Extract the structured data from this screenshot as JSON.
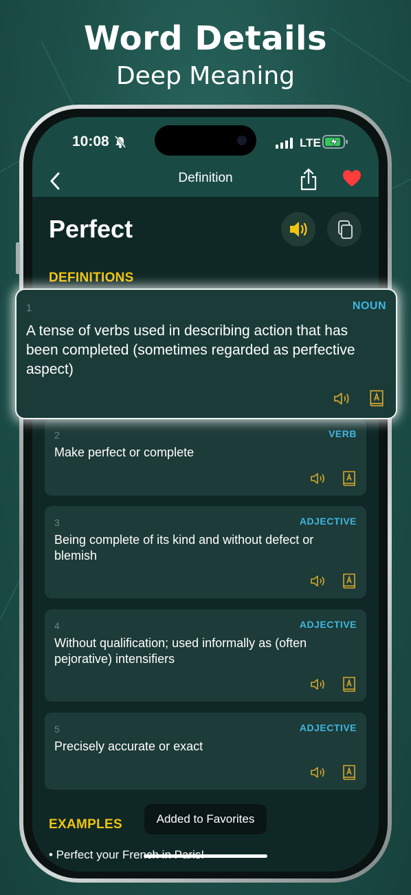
{
  "promo": {
    "title": "Word Details",
    "subtitle": "Deep Meaning"
  },
  "status_bar": {
    "time": "10:08",
    "network": "LTE"
  },
  "nav": {
    "title": "Definition"
  },
  "word": "Perfect",
  "sections": {
    "definitions": "DEFINITIONS",
    "examples": "EXAMPLES"
  },
  "definitions": [
    {
      "num": "1",
      "pos": "NOUN",
      "text": "A tense of verbs used in describing action that has been completed (sometimes regarded as perfective aspect)"
    },
    {
      "num": "2",
      "pos": "VERB",
      "text": "Make perfect or complete"
    },
    {
      "num": "3",
      "pos": "ADJECTIVE",
      "text": "Being complete of its kind and without defect or blemish"
    },
    {
      "num": "4",
      "pos": "ADJECTIVE",
      "text": "Without qualification; used informally as (often pejorative) intensifiers"
    },
    {
      "num": "5",
      "pos": "ADJECTIVE",
      "text": "Precisely accurate or exact"
    }
  ],
  "examples": [
    "• Perfect your French in Paris!"
  ],
  "toast": "Added to Favorites",
  "colors": {
    "accent_yellow": "#f1c40f",
    "pos_blue": "#3fb6e0",
    "heart_red": "#ff3b3b",
    "background": "#1e524b"
  },
  "icons": {
    "back": "chevron-left-icon",
    "share": "share-icon",
    "favorite": "heart-icon",
    "speak": "speaker-icon",
    "copy": "copy-icon",
    "dictionary": "dictionary-icon"
  }
}
